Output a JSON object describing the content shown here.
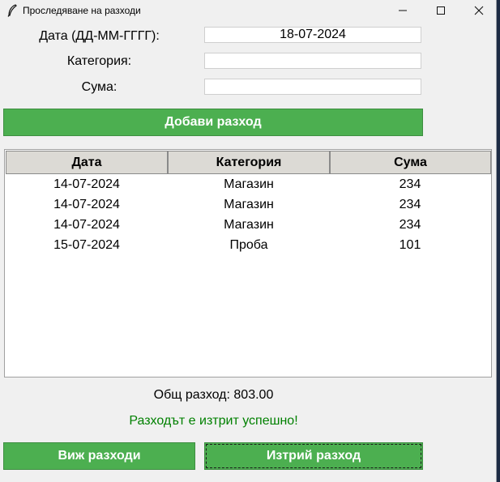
{
  "window": {
    "title": "Проследяване на разходи"
  },
  "form": {
    "date_label": "Дата (ДД-ММ-ГГГГ):",
    "date_value": "18-07-2024",
    "category_label": "Категория:",
    "category_value": "",
    "amount_label": "Сума:",
    "amount_value": ""
  },
  "add_button_label": "Добави разход",
  "table": {
    "columns": [
      "Дата",
      "Категория",
      "Сума"
    ],
    "rows": [
      [
        "14-07-2024",
        "Магазин",
        "234"
      ],
      [
        "14-07-2024",
        "Магазин",
        "234"
      ],
      [
        "14-07-2024",
        "Магазин",
        "234"
      ],
      [
        "15-07-2024",
        "Проба",
        "101"
      ]
    ]
  },
  "total_text": "Общ разход: 803.00",
  "status": {
    "text": "Разходът е изтрит успешно!",
    "color": "#008000"
  },
  "view_button_label": "Виж разходи",
  "delete_button_label": "Изтрий разход",
  "colors": {
    "button_green": "#4caf50"
  }
}
